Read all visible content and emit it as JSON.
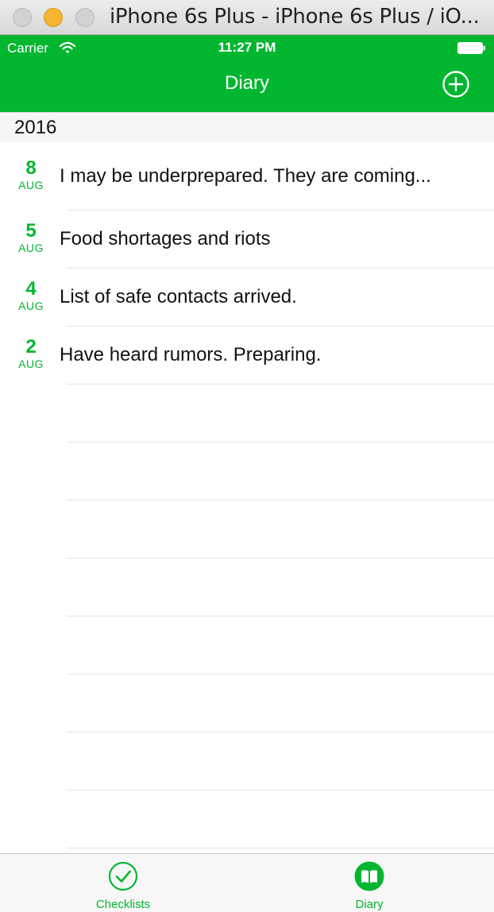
{
  "window": {
    "title": "iPhone 6s Plus - iPhone 6s Plus / iO..."
  },
  "status_bar": {
    "carrier": "Carrier",
    "time": "11:27 PM"
  },
  "nav": {
    "title": "Diary"
  },
  "section": {
    "title": "2016"
  },
  "entries": [
    {
      "day": "8",
      "month": "AUG",
      "text": "I may be underprepared. They are coming..."
    },
    {
      "day": "5",
      "month": "AUG",
      "text": "Food shortages and riots"
    },
    {
      "day": "4",
      "month": "AUG",
      "text": "List of safe contacts arrived."
    },
    {
      "day": "2",
      "month": "AUG",
      "text": "Have heard rumors. Preparing."
    }
  ],
  "tabs": [
    {
      "label": "Checklists",
      "icon": "checkmark-circle-icon",
      "selected": false
    },
    {
      "label": "Diary",
      "icon": "book-icon",
      "selected": true
    }
  ],
  "colors": {
    "accent": "#03b630",
    "titlebar": "#dcdcdc",
    "minimize": "#f5b52e"
  }
}
